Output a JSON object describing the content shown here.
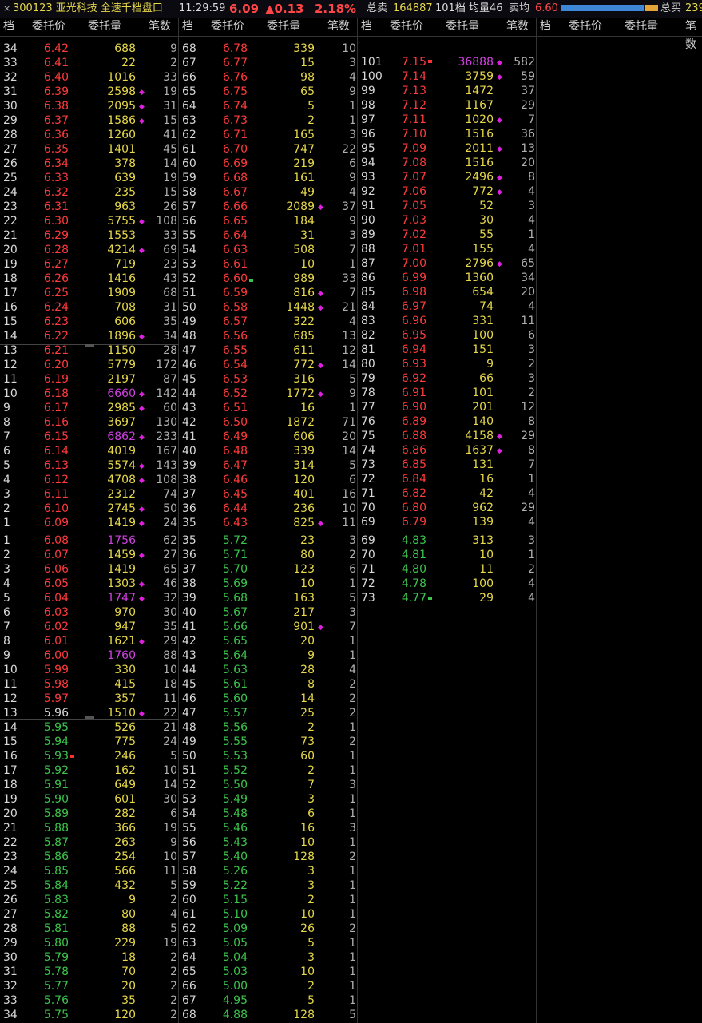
{
  "topbar": {
    "close": "×",
    "code_name": "300123 亚光科技 全速千档盘口",
    "time": "11:29:59",
    "price": "6.09",
    "change": "▲0.13",
    "pct": "2.18%",
    "sell_total_label": "总卖",
    "sell_total": "164887",
    "levels": "101档",
    "avg_vol": "均量46",
    "avg_sell_label": "卖均",
    "avg_sell": "6.60",
    "buy_total_label": "总买",
    "buy_total": "239",
    "bar_blue_fraction": 0.86,
    "bar_orange_fraction": 0.13
  },
  "header": {
    "lvl": "档",
    "price": "委托价",
    "vol": "委托量",
    "cnt": "笔数"
  },
  "asks": [
    [
      "34",
      "6.42",
      "688",
      "9"
    ],
    [
      "33",
      "6.41",
      "22",
      "2"
    ],
    [
      "32",
      "6.40",
      "1016",
      "33"
    ],
    [
      "31",
      "6.39",
      "2598",
      "19"
    ],
    [
      "30",
      "6.38",
      "2095",
      "31"
    ],
    [
      "29",
      "6.37",
      "1586",
      "15"
    ],
    [
      "28",
      "6.36",
      "1260",
      "41"
    ],
    [
      "27",
      "6.35",
      "1401",
      "45"
    ],
    [
      "26",
      "6.34",
      "378",
      "14"
    ],
    [
      "25",
      "6.33",
      "639",
      "19"
    ],
    [
      "24",
      "6.32",
      "235",
      "15"
    ],
    [
      "23",
      "6.31",
      "963",
      "26"
    ],
    [
      "22",
      "6.30",
      "5755",
      "108"
    ],
    [
      "21",
      "6.29",
      "1553",
      "33"
    ],
    [
      "20",
      "6.28",
      "4214",
      "69"
    ],
    [
      "19",
      "6.27",
      "719",
      "23"
    ],
    [
      "18",
      "6.26",
      "1416",
      "43"
    ],
    [
      "17",
      "6.25",
      "1909",
      "68"
    ],
    [
      "16",
      "6.24",
      "708",
      "31"
    ],
    [
      "15",
      "6.23",
      "606",
      "35"
    ],
    [
      "14",
      "6.22",
      "1896",
      "34"
    ],
    [
      "13",
      "6.21",
      "1150",
      "28"
    ],
    [
      "12",
      "6.20",
      "5779",
      "172"
    ],
    [
      "11",
      "6.19",
      "2197",
      "87"
    ],
    [
      "10",
      "6.18",
      "6660",
      "142"
    ],
    [
      "9",
      "6.17",
      "2985",
      "60"
    ],
    [
      "8",
      "6.16",
      "3697",
      "130"
    ],
    [
      "7",
      "6.15",
      "6862",
      "233"
    ],
    [
      "6",
      "6.14",
      "4019",
      "167"
    ],
    [
      "5",
      "6.13",
      "5574",
      "143"
    ],
    [
      "4",
      "6.12",
      "4708",
      "108"
    ],
    [
      "3",
      "6.11",
      "2312",
      "74"
    ],
    [
      "2",
      "6.10",
      "2745",
      "50"
    ],
    [
      "1",
      "6.09",
      "1419",
      "24"
    ],
    [
      "68",
      "6.78",
      "339",
      "10"
    ],
    [
      "67",
      "6.77",
      "15",
      "3"
    ],
    [
      "66",
      "6.76",
      "98",
      "4"
    ],
    [
      "65",
      "6.75",
      "65",
      "9"
    ],
    [
      "64",
      "6.74",
      "5",
      "1"
    ],
    [
      "63",
      "6.73",
      "2",
      "1"
    ],
    [
      "62",
      "6.71",
      "165",
      "3"
    ],
    [
      "61",
      "6.70",
      "747",
      "22"
    ],
    [
      "60",
      "6.69",
      "219",
      "6"
    ],
    [
      "59",
      "6.68",
      "161",
      "9"
    ],
    [
      "58",
      "6.67",
      "49",
      "4"
    ],
    [
      "57",
      "6.66",
      "2089",
      "37"
    ],
    [
      "56",
      "6.65",
      "184",
      "9"
    ],
    [
      "55",
      "6.64",
      "31",
      "3"
    ],
    [
      "54",
      "6.63",
      "508",
      "7"
    ],
    [
      "53",
      "6.61",
      "10",
      "1"
    ],
    [
      "52",
      "6.60",
      "989",
      "33"
    ],
    [
      "51",
      "6.59",
      "816",
      "7"
    ],
    [
      "50",
      "6.58",
      "1448",
      "21"
    ],
    [
      "49",
      "6.57",
      "322",
      "4"
    ],
    [
      "48",
      "6.56",
      "685",
      "13"
    ],
    [
      "47",
      "6.55",
      "611",
      "12"
    ],
    [
      "46",
      "6.54",
      "772",
      "14"
    ],
    [
      "45",
      "6.53",
      "316",
      "5"
    ],
    [
      "44",
      "6.52",
      "1772",
      "9"
    ],
    [
      "43",
      "6.51",
      "16",
      "1"
    ],
    [
      "42",
      "6.50",
      "1872",
      "71"
    ],
    [
      "41",
      "6.49",
      "606",
      "20"
    ],
    [
      "40",
      "6.48",
      "339",
      "14"
    ],
    [
      "39",
      "6.47",
      "314",
      "5"
    ],
    [
      "38",
      "6.46",
      "120",
      "6"
    ],
    [
      "37",
      "6.45",
      "401",
      "16"
    ],
    [
      "36",
      "6.44",
      "236",
      "10"
    ],
    [
      "35",
      "6.43",
      "825",
      "11"
    ],
    [
      "",
      "",
      "",
      ""
    ],
    [
      "101",
      "7.15",
      "36888",
      "582"
    ],
    [
      "100",
      "7.14",
      "3759",
      "59"
    ],
    [
      "99",
      "7.13",
      "1472",
      "37"
    ],
    [
      "98",
      "7.12",
      "1167",
      "29"
    ],
    [
      "97",
      "7.11",
      "1020",
      "7"
    ],
    [
      "96",
      "7.10",
      "1516",
      "36"
    ],
    [
      "95",
      "7.09",
      "2011",
      "13"
    ],
    [
      "94",
      "7.08",
      "1516",
      "20"
    ],
    [
      "93",
      "7.07",
      "2496",
      "8"
    ],
    [
      "92",
      "7.06",
      "772",
      "4"
    ],
    [
      "91",
      "7.05",
      "52",
      "3"
    ],
    [
      "90",
      "7.03",
      "30",
      "4"
    ],
    [
      "89",
      "7.02",
      "55",
      "1"
    ],
    [
      "88",
      "7.01",
      "155",
      "4"
    ],
    [
      "87",
      "7.00",
      "2796",
      "65"
    ],
    [
      "86",
      "6.99",
      "1360",
      "34"
    ],
    [
      "85",
      "6.98",
      "654",
      "20"
    ],
    [
      "84",
      "6.97",
      "74",
      "4"
    ],
    [
      "83",
      "6.96",
      "331",
      "11"
    ],
    [
      "82",
      "6.95",
      "100",
      "6"
    ],
    [
      "81",
      "6.94",
      "151",
      "3"
    ],
    [
      "80",
      "6.93",
      "9",
      "2"
    ],
    [
      "79",
      "6.92",
      "66",
      "3"
    ],
    [
      "78",
      "6.91",
      "101",
      "2"
    ],
    [
      "77",
      "6.90",
      "201",
      "12"
    ],
    [
      "76",
      "6.89",
      "140",
      "8"
    ],
    [
      "75",
      "6.88",
      "4158",
      "29"
    ],
    [
      "74",
      "6.86",
      "1637",
      "8"
    ],
    [
      "73",
      "6.85",
      "131",
      "7"
    ],
    [
      "72",
      "6.84",
      "16",
      "1"
    ],
    [
      "71",
      "6.82",
      "42",
      "4"
    ],
    [
      "70",
      "6.80",
      "962",
      "29"
    ],
    [
      "69",
      "6.79",
      "139",
      "4"
    ]
  ],
  "bids": [
    [
      "1",
      "6.08",
      "1756",
      "62"
    ],
    [
      "2",
      "6.07",
      "1459",
      "27"
    ],
    [
      "3",
      "6.06",
      "1419",
      "65"
    ],
    [
      "4",
      "6.05",
      "1303",
      "46"
    ],
    [
      "5",
      "6.04",
      "1747",
      "32"
    ],
    [
      "6",
      "6.03",
      "970",
      "30"
    ],
    [
      "7",
      "6.02",
      "947",
      "35"
    ],
    [
      "8",
      "6.01",
      "1621",
      "29"
    ],
    [
      "9",
      "6.00",
      "1760",
      "88"
    ],
    [
      "10",
      "5.99",
      "330",
      "10"
    ],
    [
      "11",
      "5.98",
      "415",
      "18"
    ],
    [
      "12",
      "5.97",
      "357",
      "11"
    ],
    [
      "13",
      "5.96",
      "1510",
      "22"
    ],
    [
      "14",
      "5.95",
      "526",
      "21"
    ],
    [
      "15",
      "5.94",
      "775",
      "24"
    ],
    [
      "16",
      "5.93",
      "246",
      "5"
    ],
    [
      "17",
      "5.92",
      "162",
      "10"
    ],
    [
      "18",
      "5.91",
      "649",
      "14"
    ],
    [
      "19",
      "5.90",
      "601",
      "30"
    ],
    [
      "20",
      "5.89",
      "282",
      "6"
    ],
    [
      "21",
      "5.88",
      "366",
      "19"
    ],
    [
      "22",
      "5.87",
      "263",
      "9"
    ],
    [
      "23",
      "5.86",
      "254",
      "10"
    ],
    [
      "24",
      "5.85",
      "566",
      "11"
    ],
    [
      "25",
      "5.84",
      "432",
      "5"
    ],
    [
      "26",
      "5.83",
      "9",
      "2"
    ],
    [
      "27",
      "5.82",
      "80",
      "4"
    ],
    [
      "28",
      "5.81",
      "88",
      "5"
    ],
    [
      "29",
      "5.80",
      "229",
      "19"
    ],
    [
      "30",
      "5.79",
      "18",
      "2"
    ],
    [
      "31",
      "5.78",
      "70",
      "2"
    ],
    [
      "32",
      "5.77",
      "20",
      "2"
    ],
    [
      "33",
      "5.76",
      "35",
      "2"
    ],
    [
      "34",
      "5.75",
      "120",
      "2"
    ],
    [
      "35",
      "5.72",
      "23",
      "3"
    ],
    [
      "36",
      "5.71",
      "80",
      "2"
    ],
    [
      "37",
      "5.70",
      "123",
      "6"
    ],
    [
      "38",
      "5.69",
      "10",
      "1"
    ],
    [
      "39",
      "5.68",
      "163",
      "5"
    ],
    [
      "40",
      "5.67",
      "217",
      "3"
    ],
    [
      "41",
      "5.66",
      "901",
      "7"
    ],
    [
      "42",
      "5.65",
      "20",
      "1"
    ],
    [
      "43",
      "5.64",
      "9",
      "1"
    ],
    [
      "44",
      "5.63",
      "28",
      "4"
    ],
    [
      "45",
      "5.61",
      "8",
      "2"
    ],
    [
      "46",
      "5.60",
      "14",
      "2"
    ],
    [
      "47",
      "5.57",
      "25",
      "2"
    ],
    [
      "48",
      "5.56",
      "2",
      "1"
    ],
    [
      "49",
      "5.55",
      "73",
      "2"
    ],
    [
      "50",
      "5.53",
      "60",
      "1"
    ],
    [
      "51",
      "5.52",
      "2",
      "1"
    ],
    [
      "52",
      "5.50",
      "7",
      "3"
    ],
    [
      "53",
      "5.49",
      "3",
      "1"
    ],
    [
      "54",
      "5.48",
      "6",
      "1"
    ],
    [
      "55",
      "5.46",
      "16",
      "3"
    ],
    [
      "56",
      "5.43",
      "10",
      "1"
    ],
    [
      "57",
      "5.40",
      "128",
      "2"
    ],
    [
      "58",
      "5.26",
      "3",
      "1"
    ],
    [
      "59",
      "5.22",
      "3",
      "1"
    ],
    [
      "60",
      "5.15",
      "2",
      "1"
    ],
    [
      "61",
      "5.10",
      "10",
      "1"
    ],
    [
      "62",
      "5.09",
      "26",
      "2"
    ],
    [
      "63",
      "5.05",
      "5",
      "1"
    ],
    [
      "64",
      "5.04",
      "3",
      "1"
    ],
    [
      "65",
      "5.03",
      "10",
      "1"
    ],
    [
      "66",
      "5.00",
      "2",
      "1"
    ],
    [
      "67",
      "4.95",
      "5",
      "1"
    ],
    [
      "68",
      "4.88",
      "128",
      "5"
    ],
    [
      "69",
      "4.83",
      "313",
      "3"
    ],
    [
      "70",
      "4.81",
      "10",
      "1"
    ],
    [
      "71",
      "4.80",
      "11",
      "2"
    ],
    [
      "72",
      "4.78",
      "100",
      "4"
    ],
    [
      "73",
      "4.77",
      "29",
      "4"
    ]
  ],
  "purple_vols": [
    "6660",
    "6862",
    "1756",
    "1747",
    "1760",
    "36888"
  ],
  "diamond_vols_ask": [
    "2598",
    "2095",
    "1586",
    "5755",
    "4214",
    "1896",
    "6660",
    "2985",
    "6862",
    "5574",
    "4708",
    "2745",
    "1419",
    "2089",
    "816",
    "1448",
    "772",
    "1772",
    "825",
    "36888",
    "3759",
    "1020",
    "2011",
    "2496",
    "772",
    "2796",
    "4158",
    "1637"
  ],
  "diamond_vols_bid": [
    "1459",
    "1303",
    "1747",
    "1621",
    "1510",
    "901"
  ],
  "colors": {
    "up": "#ff3b3b",
    "down": "#3bc44b",
    "vol": "#e6d84a",
    "purple": "#d040e0"
  }
}
